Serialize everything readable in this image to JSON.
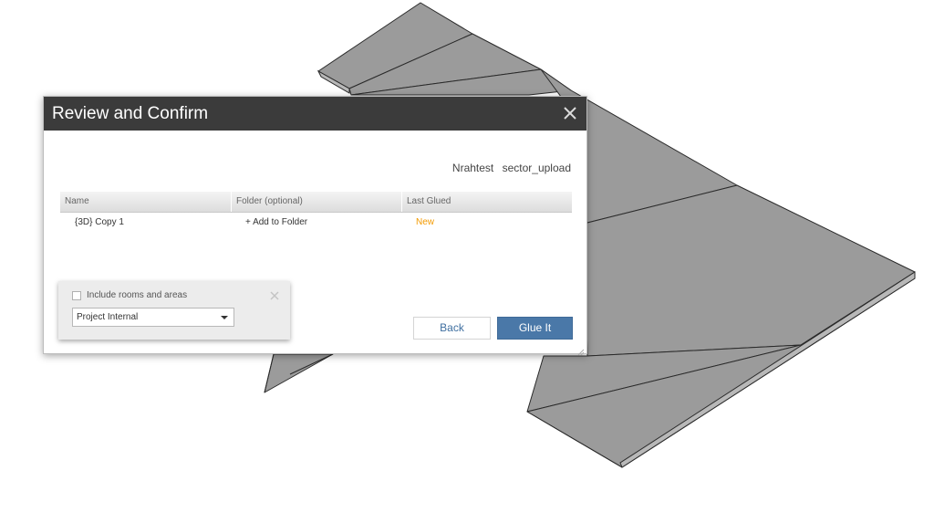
{
  "dialog": {
    "title": "Review and Confirm",
    "project_name": "Nrahtest",
    "model_name": "sector_upload"
  },
  "table": {
    "headers": {
      "name": "Name",
      "folder": "Folder (optional)",
      "last_glued": "Last Glued"
    },
    "rows": [
      {
        "name": "{3D} Copy 1",
        "folder": "+ Add to Folder",
        "last_glued": "New"
      }
    ]
  },
  "options": {
    "include_rooms_label": "Include rooms and areas",
    "include_rooms_checked": false,
    "visibility_selected": "Project Internal"
  },
  "buttons": {
    "back_label": "Back",
    "glue_label": "Glue It"
  },
  "colors": {
    "header_bg": "#3b3b3b",
    "primary_button": "#4a78a8",
    "status_new": "#f39a00",
    "model_face": "#9b9b9b"
  },
  "icons": {
    "dialog_close": "close-icon",
    "options_close": "close-icon",
    "select_caret": "chevron-down-icon",
    "resize": "resize-grip-icon"
  }
}
